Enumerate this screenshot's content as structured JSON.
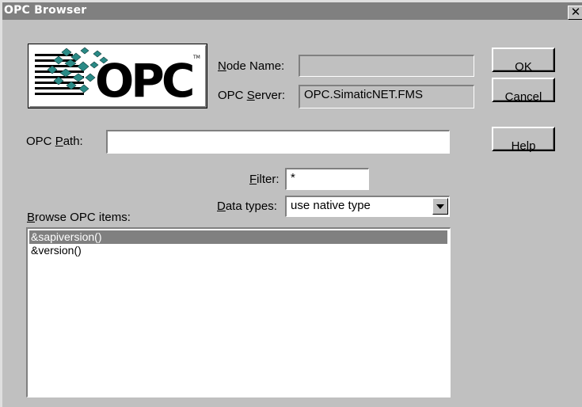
{
  "window": {
    "title": "OPC Browser",
    "close_glyph": "✕"
  },
  "logo": {
    "text": "OPC",
    "trademark": "TM"
  },
  "node_name": {
    "label_key": "N",
    "label_rest": "ode Name:",
    "value": ""
  },
  "opc_server": {
    "label_pre": "OPC ",
    "label_key": "S",
    "label_rest": "erver:",
    "value": "OPC.SimaticNET.FMS"
  },
  "opc_path": {
    "label_pre": "OPC ",
    "label_key": "P",
    "label_rest": "ath:",
    "value": ""
  },
  "filter": {
    "label_key": "F",
    "label_rest": "ilter:",
    "value": "*"
  },
  "data_types": {
    "label_key": "D",
    "label_rest": "ata types:",
    "selected": "use native type"
  },
  "browse": {
    "label_key": "B",
    "label_rest": "rowse OPC items:",
    "items": [
      "&sapiversion()",
      "&version()"
    ]
  },
  "buttons": {
    "ok": {
      "key": "O",
      "rest": "K"
    },
    "cancel": {
      "key": "C",
      "rest": "ancel"
    },
    "help": {
      "key": "H",
      "rest": "elp"
    }
  },
  "colors": {
    "face": "#c0c0c0",
    "title_bar": "#808080",
    "selection": "#808080",
    "logo_teal": "#2a8a86"
  }
}
